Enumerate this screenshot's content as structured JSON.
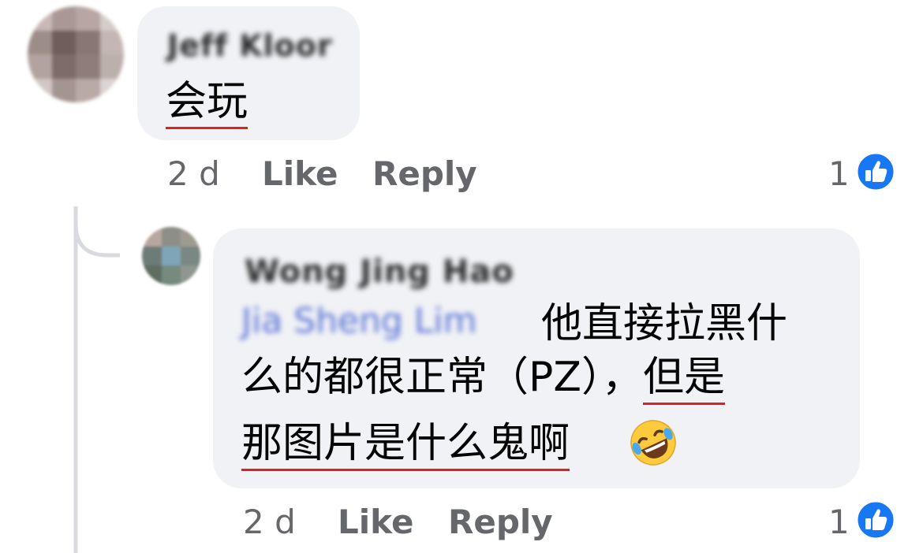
{
  "colors": {
    "bubble": "#f0f2f5",
    "meta_text": "#65676b",
    "like_blue": "#1877f2",
    "underline_red": "#e02020"
  },
  "comments": [
    {
      "author": "Jeff Kloor",
      "text": "会玩",
      "time": "2 d",
      "like_label": "Like",
      "reply_label": "Reply",
      "reaction_count": "1",
      "reaction_icon": "thumbs-up-icon"
    },
    {
      "author": "Wong Jing Hao",
      "mention": "Jia Sheng Lim",
      "text_line1": "他直接拉黑什",
      "text_line2": "么的都很正常（PZ），但是",
      "text_line3": "那图片是什么鬼啊",
      "emoji": "rolling-on-floor-laughing-emoji",
      "time": "2 d",
      "like_label": "Like",
      "reply_label": "Reply",
      "reaction_count": "1",
      "reaction_icon": "thumbs-up-icon"
    }
  ]
}
